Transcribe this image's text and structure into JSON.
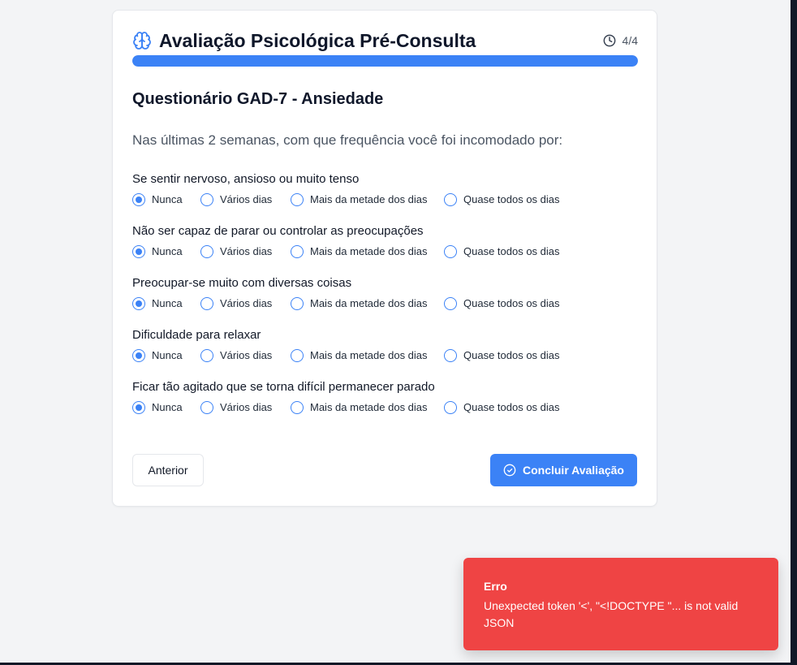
{
  "app": {
    "title": "Avaliação Psicológica Pré-Consulta",
    "step": "4/4",
    "progress": 1.0,
    "accent_color": "#3b82f6",
    "icons": {
      "title": "brain-icon",
      "step": "clock-icon"
    }
  },
  "section": {
    "title": "Questionário GAD-7 - Ansiedade",
    "instruction": "Nas últimas 2 semanas, com que frequência você foi incomodado por:"
  },
  "options": [
    "Nunca",
    "Vários dias",
    "Mais da metade dos dias",
    "Quase todos os dias"
  ],
  "questions": [
    {
      "text": "Se sentir nervoso, ansioso ou muito tenso",
      "selected": "Nunca"
    },
    {
      "text": "Não ser capaz de parar ou controlar as preocupações",
      "selected": "Nunca"
    },
    {
      "text": "Preocupar-se muito com diversas coisas",
      "selected": "Nunca"
    },
    {
      "text": "Dificuldade para relaxar",
      "selected": "Nunca"
    },
    {
      "text": "Ficar tão agitado que se torna difícil permanecer parado",
      "selected": "Nunca"
    }
  ],
  "buttons": {
    "previous": "Anterior",
    "finish": "Concluir Avaliação",
    "finish_icon": "check-circle-icon"
  },
  "toast": {
    "title": "Erro",
    "message": "Unexpected token '<', \"<!DOCTYPE \"... is not valid JSON",
    "color": "#ef4444"
  }
}
